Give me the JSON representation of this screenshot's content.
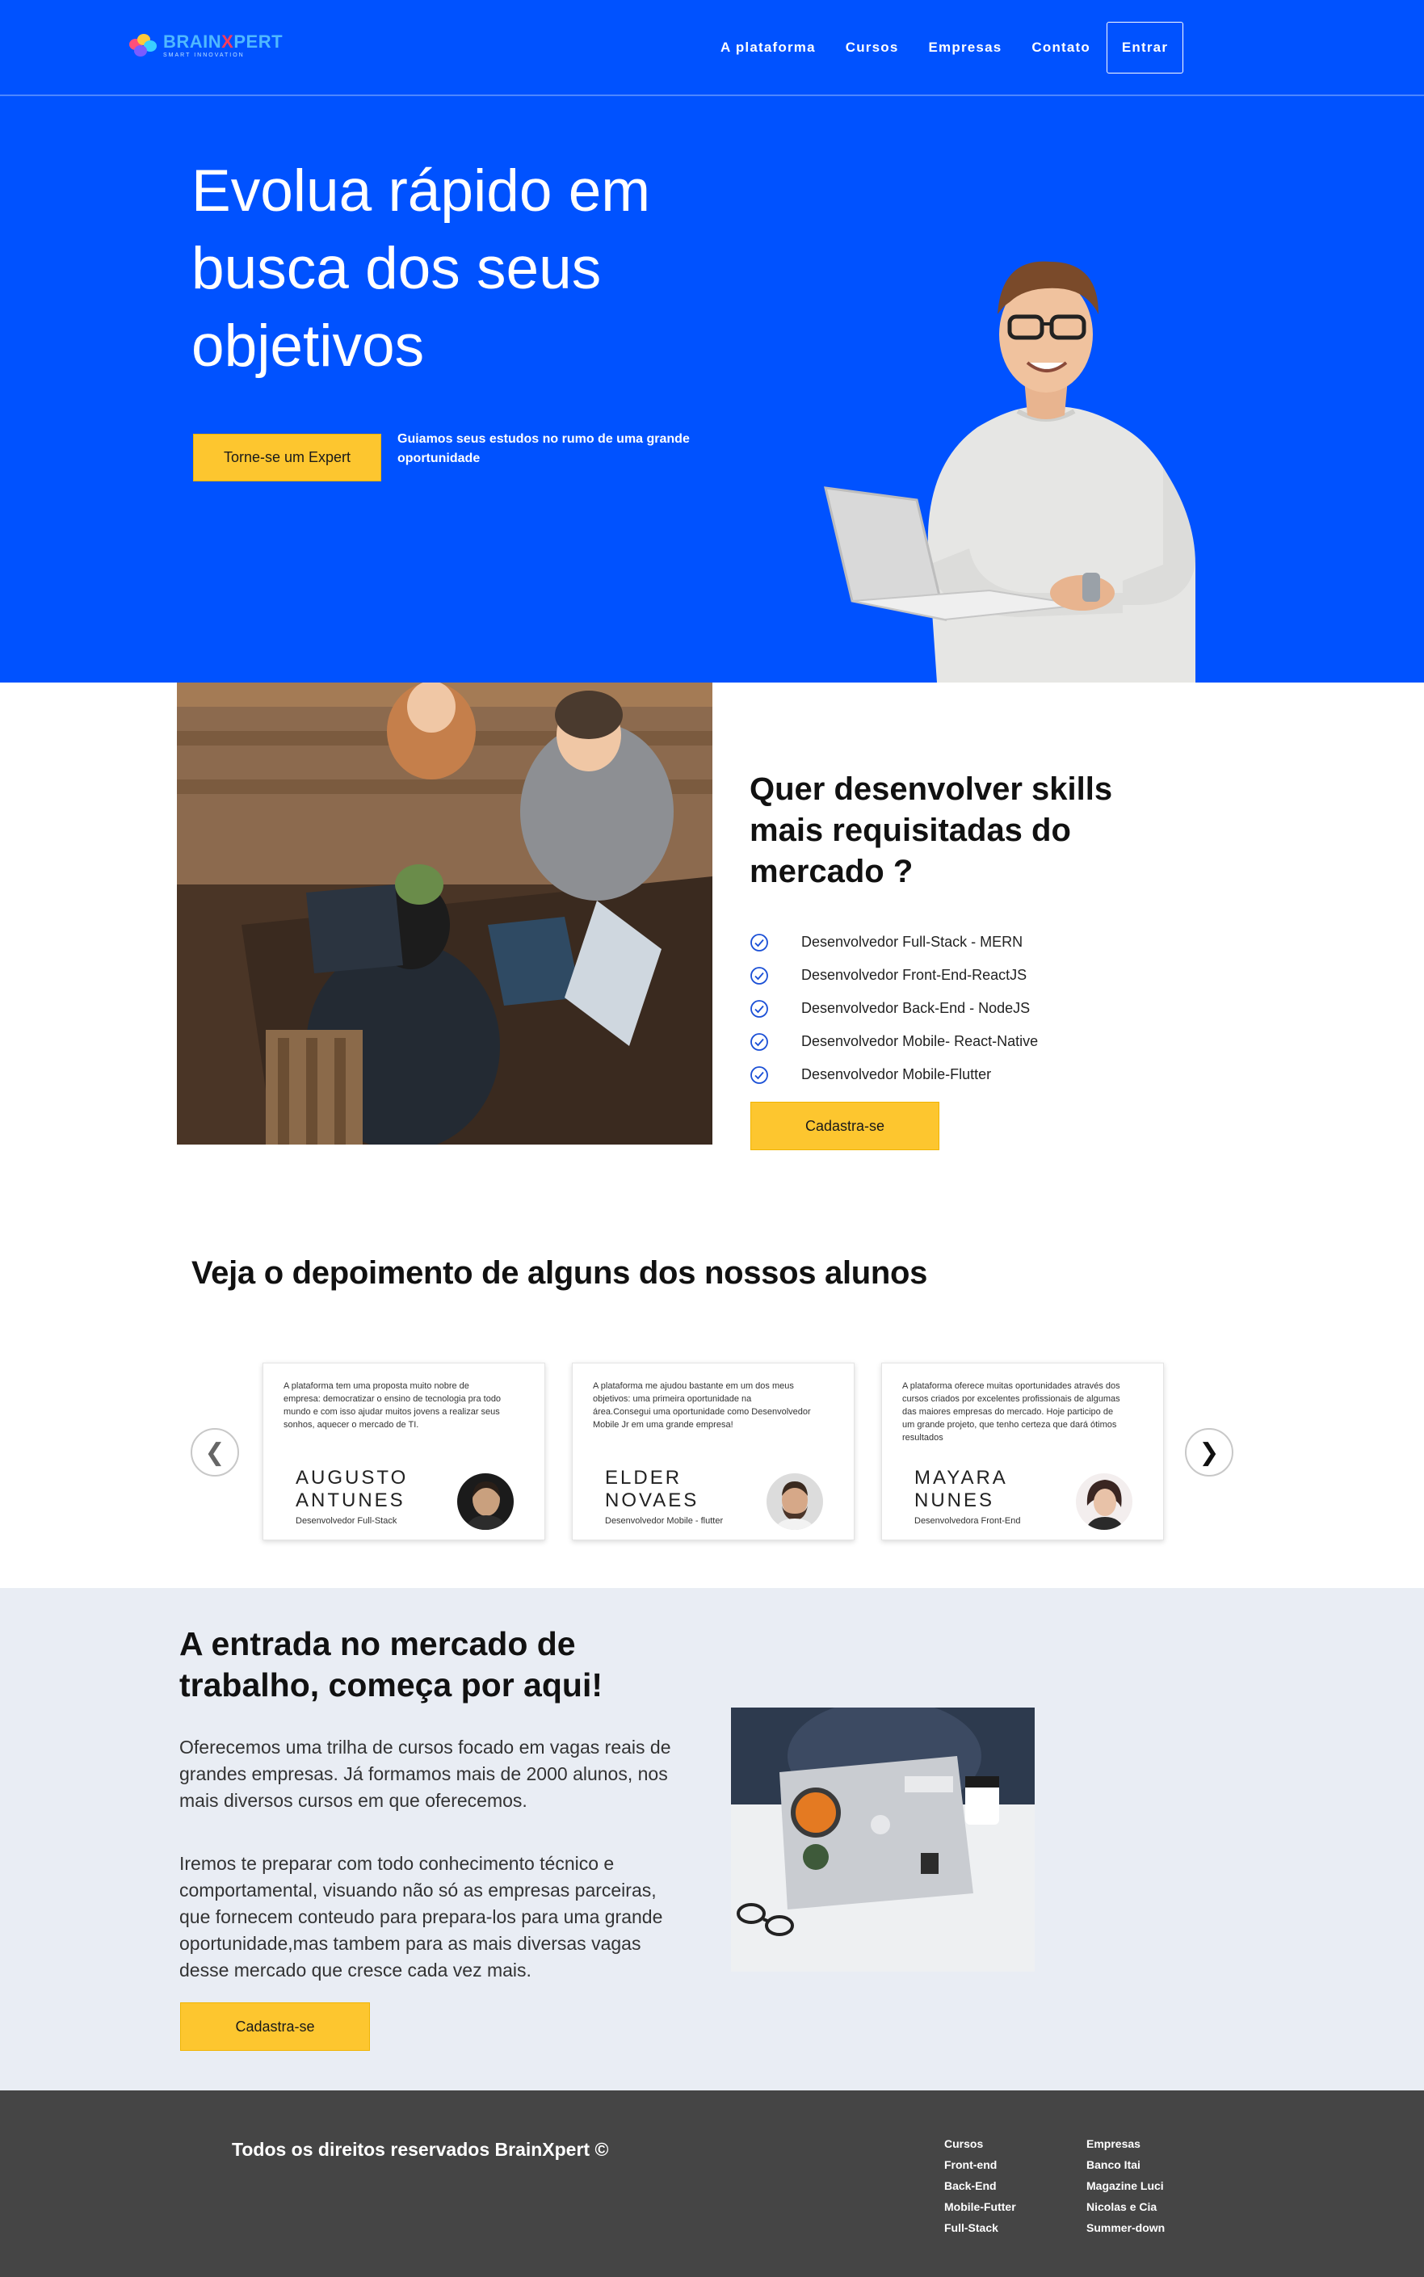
{
  "brand": {
    "name_part1": "BRAIN",
    "name_x": "X",
    "name_part2": "PERT",
    "tagline": "SMART INNOVATION"
  },
  "nav": {
    "items": [
      "A plataforma",
      "Cursos",
      "Empresas",
      "Contato"
    ],
    "login_label": "Entrar"
  },
  "hero": {
    "title": "Evolua rápido em busca dos seus objetivos",
    "cta_label": "Torne-se um Expert",
    "subtitle": "Guiamos seus estudos no rumo de uma grande oportunidade"
  },
  "skills": {
    "title": "Quer desenvolver skills mais requisitadas do mercado ?",
    "items": [
      "Desenvolvedor Full-Stack - MERN",
      "Desenvolvedor Front-End-ReactJS",
      "Desenvolvedor Back-End - NodeJS",
      "Desenvolvedor Mobile- React-Native",
      "Desenvolvedor Mobile-Flutter"
    ],
    "cta_label": "Cadastra-se"
  },
  "testimonials": {
    "title": "Veja o depoimento de alguns dos nossos alunos",
    "prev_symbol": "❮",
    "next_symbol": "❯",
    "cards": [
      {
        "quote": "A plataforma tem uma proposta muito nobre de empresa: democratizar o ensino de tecnologia pra todo mundo e com isso ajudar muitos jovens a realizar seus sonhos, aquecer o mercado de TI.",
        "name": "AUGUSTO ANTUNES",
        "role": "Desenvolvedor Full-Stack"
      },
      {
        "quote": "A plataforma me ajudou bastante em um dos meus objetivos: uma primeira oportunidade na área.Consegui uma oportunidade como Desenvolvedor Mobile Jr em uma grande empresa!",
        "name": "ELDER NOVAES",
        "role": "Desenvolvedor Mobile - flutter"
      },
      {
        "quote": "A plataforma oferece muitas oportunidades através dos cursos criados por excelentes profissionais de algumas das maiores empresas do mercado. Hoje participo de um grande projeto, que tenho certeza que dará ótimos resultados",
        "name": "MAYARA NUNES",
        "role": "Desenvolvedora Front-End"
      }
    ]
  },
  "market": {
    "title": "A entrada no mercado de trabalho, começa por aqui!",
    "paragraph1": "Oferecemos uma trilha de cursos focado em vagas reais de grandes empresas. Já formamos mais de 2000 alunos, nos mais diversos cursos em que oferecemos.",
    "paragraph2": "Iremos te preparar com todo conhecimento técnico e comportamental, visuando não só as empresas parceiras, que fornecem conteudo para prepara-los para uma grande oportunidade,mas tambem para as mais diversas vagas desse mercado que cresce cada vez mais.",
    "cta_label": "Cadastra-se"
  },
  "footer": {
    "copyright": "Todos os direitos reservados BrainXpert ©",
    "courses": [
      "Cursos",
      "Front-end",
      "Back-End",
      "Mobile-Futter",
      "Full-Stack"
    ],
    "companies": [
      "Empresas",
      "Banco Itai",
      "Magazine Luci",
      "Nicolas e Cia",
      "Summer-down"
    ]
  },
  "colors": {
    "primary_blue": "#0052ff",
    "cta_yellow": "#fdc62f",
    "market_bg": "#e9edf4",
    "footer_bg": "#454545"
  },
  "icons": {
    "skill_bullet": "check-circle-icon",
    "carousel_prev": "chevron-left-icon",
    "carousel_next": "chevron-right-icon"
  }
}
